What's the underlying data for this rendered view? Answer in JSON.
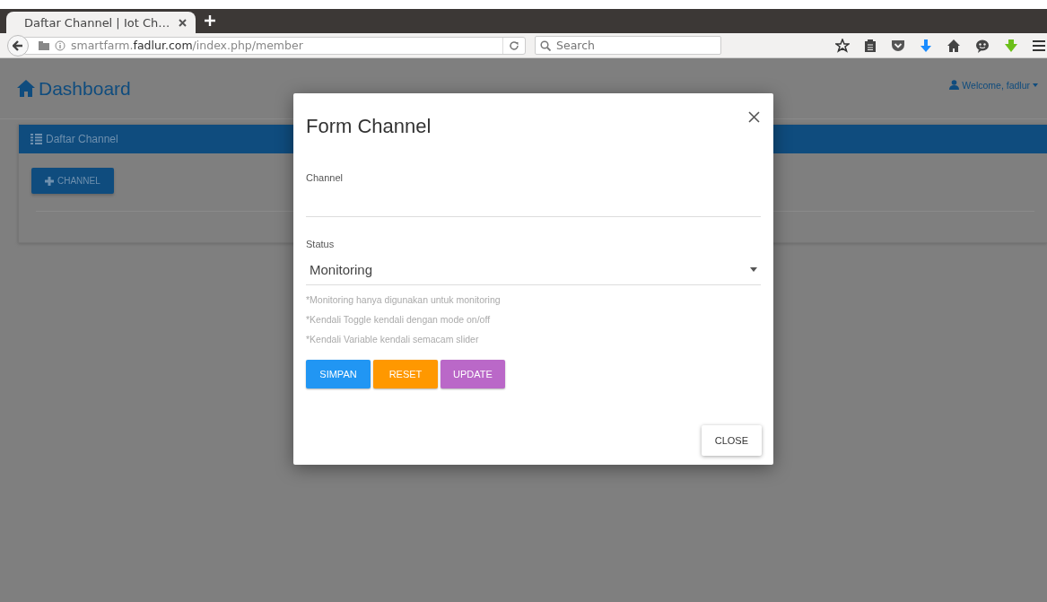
{
  "browser": {
    "tabs": [
      {
        "title": "Daftar Channel | Iot Ch…",
        "selected": true
      }
    ],
    "url": "smartfarm.**fadlur.com**/index.php/member",
    "search": {
      "placeholder": "Search"
    }
  },
  "app": {
    "brand": "Dashboard",
    "user_menu": "Welcome, fadlur",
    "panel": {
      "title": "Daftar Channel",
      "add_button": "CHANNEL"
    }
  },
  "modal": {
    "title": "Form Channel",
    "fields": [
      {
        "kind": "text",
        "label": "Channel"
      },
      {
        "kind": "select",
        "label": "Status",
        "value": "Monitoring"
      }
    ],
    "hints": [
      "*Monitoring hanya digunakan untuk monitoring",
      "*Kendali Toggle kendali dengan mode on/off",
      "*Kendali Variable kendali semacam slider"
    ],
    "buttons": [
      {
        "label": "SIMPAN",
        "color": "#2196f3"
      },
      {
        "label": "RESET",
        "color": "#ff9800"
      },
      {
        "label": "UPDATE",
        "color": "#ba68c8"
      }
    ],
    "close_button": "CLOSE"
  }
}
